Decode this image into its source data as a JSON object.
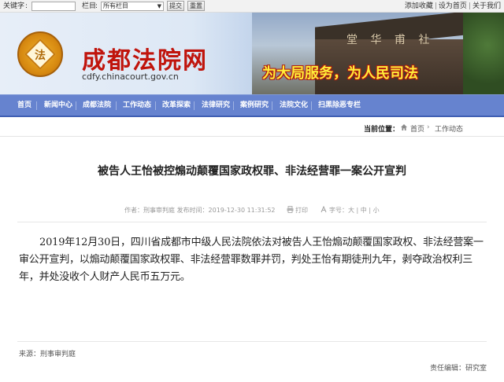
{
  "topbar": {
    "keyword_label": "关键字",
    "keyword_value": "",
    "column_label": "栏目",
    "column_selected": "所有栏目",
    "submit_label": "提交",
    "reset_label": "重置",
    "links": [
      "添加收藏",
      "设为首页",
      "关于我们"
    ]
  },
  "banner": {
    "site_name": "成都法院网",
    "domain": "cdfy.chinacourt.gov.cn",
    "slogan": "为大局服务，为人民司法",
    "plaque": "堂 华 甫 社",
    "logo_mark": "法"
  },
  "nav": {
    "items": [
      "首页",
      "新闻中心",
      "成都法院",
      "工作动态",
      "改革探索",
      "法律研究",
      "案例研究",
      "法院文化",
      "扫黑除恶专栏"
    ]
  },
  "breadcrumb": {
    "label": "当前位置：",
    "home": "首页",
    "arrow": "›",
    "current": "工作动态"
  },
  "article": {
    "title": "被告人王怡被控煽动颠覆国家政权罪、非法经营罪一案公开宣判",
    "meta_info": "作者：刑事审判庭  发布时间：2019-12-30 11:31:52",
    "print_label": "打印",
    "font_label": "字号：",
    "font_sizes": [
      "大",
      "中",
      "小"
    ],
    "body": "2019年12月30日，四川省成都市中级人民法院依法对被告人王怡煽动颠覆国家政权、非法经营案一审公开宣判，以煽动颠覆国家政权罪、非法经营罪数罪并罚，判处王怡有期徒刑九年，剥夺政治权利三年，并处没收个人财产人民币五万元。",
    "source": "来源：刑事审判庭",
    "editor": "责任编辑：研究室"
  },
  "colors": {
    "nav_bg": "#6683cf",
    "site_name": "#c0140c",
    "slogan": "#ffef3a"
  }
}
